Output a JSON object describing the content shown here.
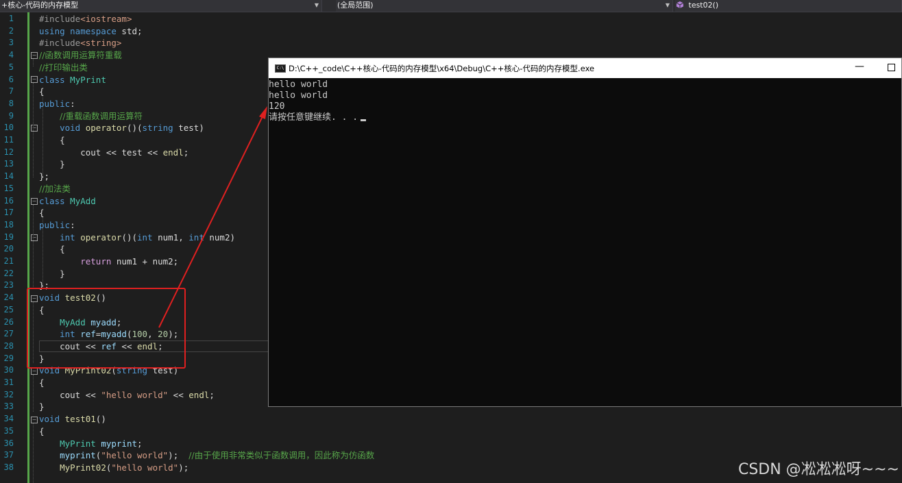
{
  "nav": {
    "file_scope": "+核心-代码的内存模型",
    "scope": "(全局范围)",
    "member": "test02()"
  },
  "editor": {
    "line_numbers": [
      "1",
      "2",
      "3",
      "4",
      "5",
      "6",
      "7",
      "8",
      "9",
      "10",
      "11",
      "12",
      "13",
      "14",
      "15",
      "16",
      "17",
      "18",
      "19",
      "20",
      "21",
      "22",
      "23",
      "24",
      "25",
      "26",
      "27",
      "28",
      "29",
      "30",
      "31",
      "32",
      "33",
      "34",
      "35",
      "36",
      "37",
      "38"
    ]
  },
  "console": {
    "title": "D:\\C++_code\\C++核心-代码的内存模型\\x64\\Debug\\C++核心-代码的内存模型.exe",
    "icon_text": "C:\\",
    "lines": [
      "hello world",
      "hello world",
      "120",
      "请按任意键继续. . ."
    ]
  },
  "colors": {
    "keyword": "#569cd6",
    "type": "#4ec9b0",
    "comment": "#57a64a",
    "string": "#d69d85",
    "line_number": "#2b91af",
    "annotation": "#e02020"
  },
  "watermark": "CSDN @凇凇凇呀~~~"
}
